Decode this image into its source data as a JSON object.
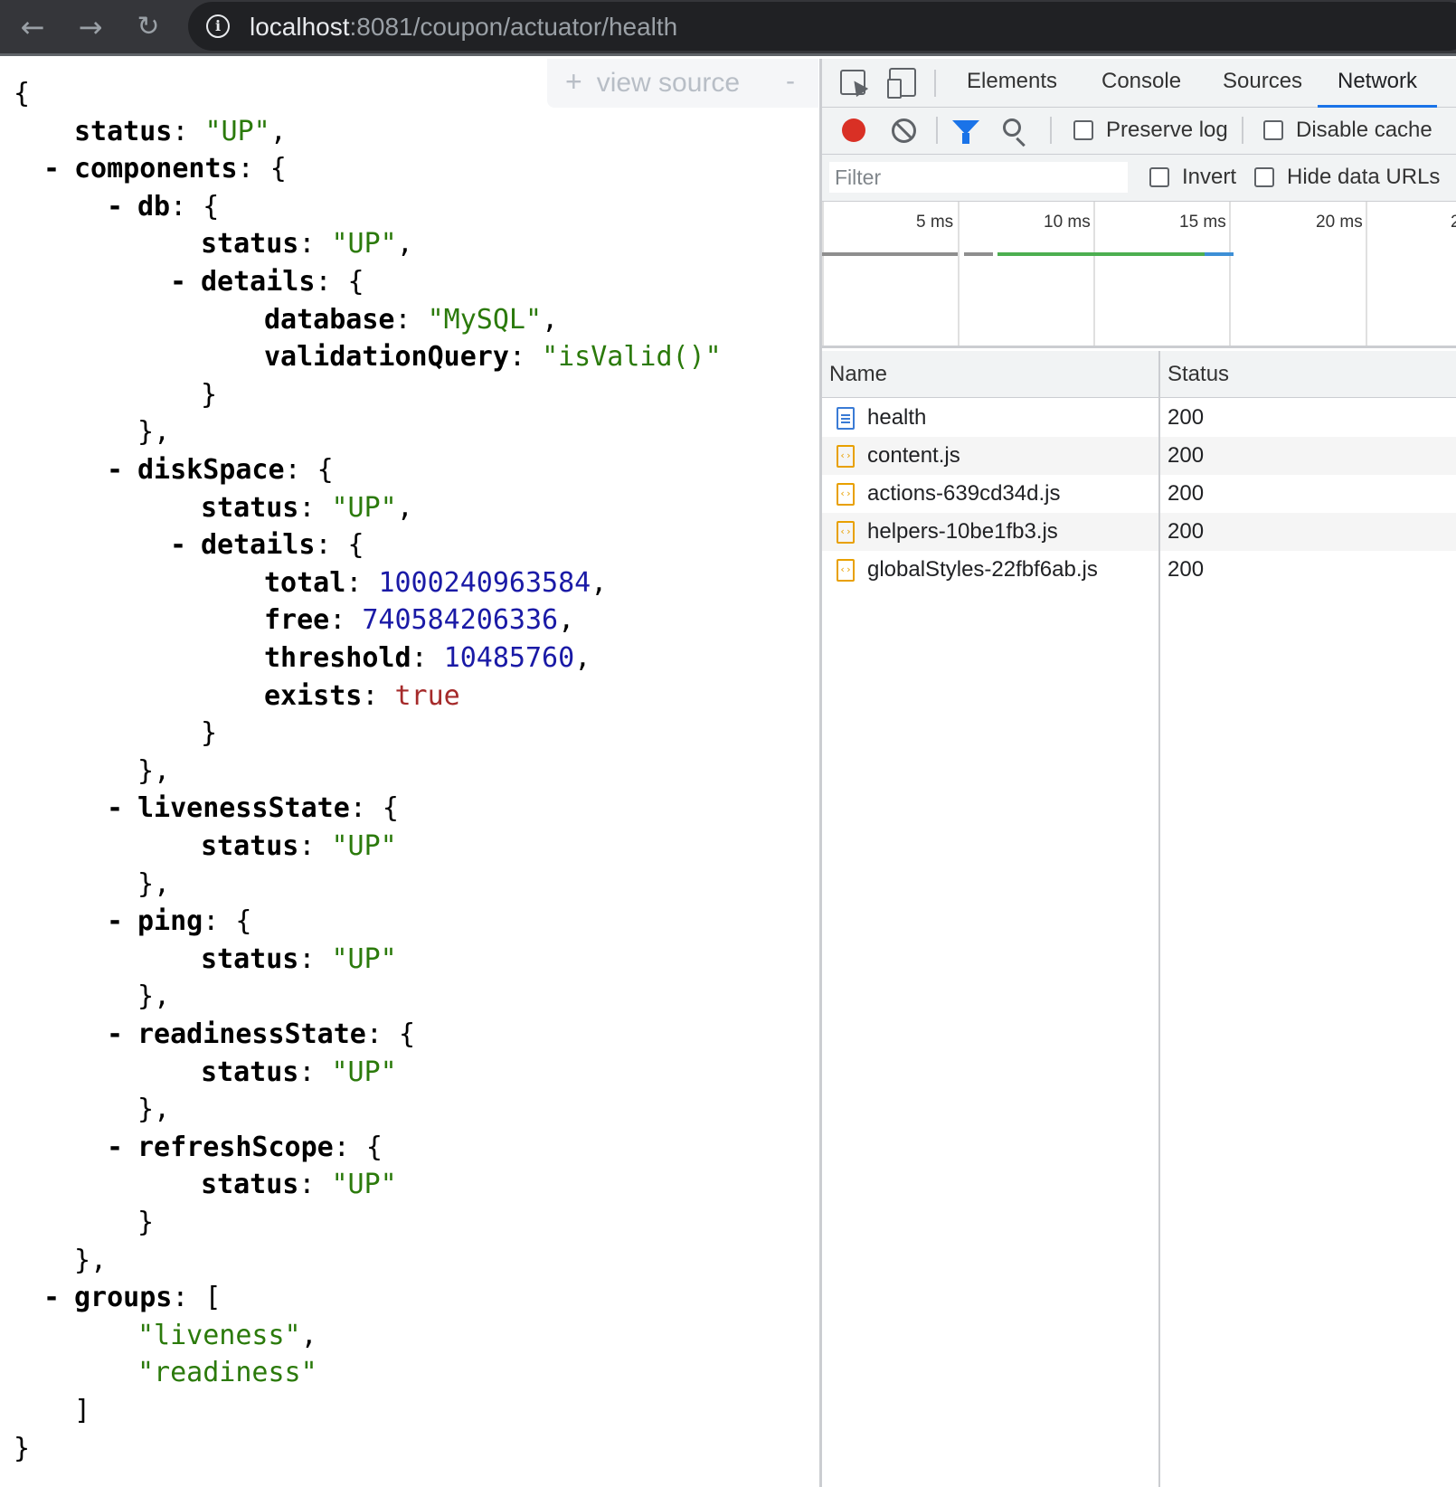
{
  "browser": {
    "nav": {
      "back_icon": "←",
      "forward_icon": "→",
      "reload_icon": "↻"
    },
    "omnibox": {
      "info_icon": "i",
      "url_host": "localhost",
      "url_rest": ":8081/coupon/actuator/health"
    }
  },
  "json_viewer": {
    "view_source": {
      "plus": "+",
      "label": "view source",
      "minus": "-"
    },
    "lines": [
      {
        "indent": 0,
        "collapse": false,
        "parts": [
          {
            "t": "p",
            "v": "{"
          }
        ]
      },
      {
        "indent": 1,
        "collapse": false,
        "parts": [
          {
            "t": "k",
            "v": "status"
          },
          {
            "t": "p",
            "v": ": "
          },
          {
            "t": "s",
            "v": "\"UP\""
          },
          {
            "t": "p",
            "v": ","
          }
        ]
      },
      {
        "indent": 1,
        "collapse": true,
        "parts": [
          {
            "t": "k",
            "v": "components"
          },
          {
            "t": "p",
            "v": ": {"
          }
        ]
      },
      {
        "indent": 2,
        "collapse": true,
        "parts": [
          {
            "t": "k",
            "v": "db"
          },
          {
            "t": "p",
            "v": ": {"
          }
        ]
      },
      {
        "indent": 3,
        "collapse": false,
        "parts": [
          {
            "t": "k",
            "v": "status"
          },
          {
            "t": "p",
            "v": ": "
          },
          {
            "t": "s",
            "v": "\"UP\""
          },
          {
            "t": "p",
            "v": ","
          }
        ]
      },
      {
        "indent": 3,
        "collapse": true,
        "parts": [
          {
            "t": "k",
            "v": "details"
          },
          {
            "t": "p",
            "v": ": {"
          }
        ]
      },
      {
        "indent": 4,
        "collapse": false,
        "parts": [
          {
            "t": "k",
            "v": "database"
          },
          {
            "t": "p",
            "v": ": "
          },
          {
            "t": "s",
            "v": "\"MySQL\""
          },
          {
            "t": "p",
            "v": ","
          }
        ]
      },
      {
        "indent": 4,
        "collapse": false,
        "parts": [
          {
            "t": "k",
            "v": "validationQuery"
          },
          {
            "t": "p",
            "v": ": "
          },
          {
            "t": "s",
            "v": "\"isValid()\""
          }
        ]
      },
      {
        "indent": 3,
        "collapse": false,
        "parts": [
          {
            "t": "p",
            "v": "}"
          }
        ]
      },
      {
        "indent": 2,
        "collapse": false,
        "parts": [
          {
            "t": "p",
            "v": "},"
          }
        ]
      },
      {
        "indent": 2,
        "collapse": true,
        "parts": [
          {
            "t": "k",
            "v": "diskSpace"
          },
          {
            "t": "p",
            "v": ": {"
          }
        ]
      },
      {
        "indent": 3,
        "collapse": false,
        "parts": [
          {
            "t": "k",
            "v": "status"
          },
          {
            "t": "p",
            "v": ": "
          },
          {
            "t": "s",
            "v": "\"UP\""
          },
          {
            "t": "p",
            "v": ","
          }
        ]
      },
      {
        "indent": 3,
        "collapse": true,
        "parts": [
          {
            "t": "k",
            "v": "details"
          },
          {
            "t": "p",
            "v": ": {"
          }
        ]
      },
      {
        "indent": 4,
        "collapse": false,
        "parts": [
          {
            "t": "k",
            "v": "total"
          },
          {
            "t": "p",
            "v": ": "
          },
          {
            "t": "n",
            "v": "1000240963584"
          },
          {
            "t": "p",
            "v": ","
          }
        ]
      },
      {
        "indent": 4,
        "collapse": false,
        "parts": [
          {
            "t": "k",
            "v": "free"
          },
          {
            "t": "p",
            "v": ": "
          },
          {
            "t": "n",
            "v": "740584206336"
          },
          {
            "t": "p",
            "v": ","
          }
        ]
      },
      {
        "indent": 4,
        "collapse": false,
        "parts": [
          {
            "t": "k",
            "v": "threshold"
          },
          {
            "t": "p",
            "v": ": "
          },
          {
            "t": "n",
            "v": "10485760"
          },
          {
            "t": "p",
            "v": ","
          }
        ]
      },
      {
        "indent": 4,
        "collapse": false,
        "parts": [
          {
            "t": "k",
            "v": "exists"
          },
          {
            "t": "p",
            "v": ": "
          },
          {
            "t": "b",
            "v": "true"
          }
        ]
      },
      {
        "indent": 3,
        "collapse": false,
        "parts": [
          {
            "t": "p",
            "v": "}"
          }
        ]
      },
      {
        "indent": 2,
        "collapse": false,
        "parts": [
          {
            "t": "p",
            "v": "},"
          }
        ]
      },
      {
        "indent": 2,
        "collapse": true,
        "parts": [
          {
            "t": "k",
            "v": "livenessState"
          },
          {
            "t": "p",
            "v": ": {"
          }
        ]
      },
      {
        "indent": 3,
        "collapse": false,
        "parts": [
          {
            "t": "k",
            "v": "status"
          },
          {
            "t": "p",
            "v": ": "
          },
          {
            "t": "s",
            "v": "\"UP\""
          }
        ]
      },
      {
        "indent": 2,
        "collapse": false,
        "parts": [
          {
            "t": "p",
            "v": "},"
          }
        ]
      },
      {
        "indent": 2,
        "collapse": true,
        "parts": [
          {
            "t": "k",
            "v": "ping"
          },
          {
            "t": "p",
            "v": ": {"
          }
        ]
      },
      {
        "indent": 3,
        "collapse": false,
        "parts": [
          {
            "t": "k",
            "v": "status"
          },
          {
            "t": "p",
            "v": ": "
          },
          {
            "t": "s",
            "v": "\"UP\""
          }
        ]
      },
      {
        "indent": 2,
        "collapse": false,
        "parts": [
          {
            "t": "p",
            "v": "},"
          }
        ]
      },
      {
        "indent": 2,
        "collapse": true,
        "parts": [
          {
            "t": "k",
            "v": "readinessState"
          },
          {
            "t": "p",
            "v": ": {"
          }
        ]
      },
      {
        "indent": 3,
        "collapse": false,
        "parts": [
          {
            "t": "k",
            "v": "status"
          },
          {
            "t": "p",
            "v": ": "
          },
          {
            "t": "s",
            "v": "\"UP\""
          }
        ]
      },
      {
        "indent": 2,
        "collapse": false,
        "parts": [
          {
            "t": "p",
            "v": "},"
          }
        ]
      },
      {
        "indent": 2,
        "collapse": true,
        "parts": [
          {
            "t": "k",
            "v": "refreshScope"
          },
          {
            "t": "p",
            "v": ": {"
          }
        ]
      },
      {
        "indent": 3,
        "collapse": false,
        "parts": [
          {
            "t": "k",
            "v": "status"
          },
          {
            "t": "p",
            "v": ": "
          },
          {
            "t": "s",
            "v": "\"UP\""
          }
        ]
      },
      {
        "indent": 2,
        "collapse": false,
        "parts": [
          {
            "t": "p",
            "v": "}"
          }
        ]
      },
      {
        "indent": 1,
        "collapse": false,
        "parts": [
          {
            "t": "p",
            "v": "},"
          }
        ]
      },
      {
        "indent": 1,
        "collapse": true,
        "parts": [
          {
            "t": "k",
            "v": "groups"
          },
          {
            "t": "p",
            "v": ": ["
          }
        ]
      },
      {
        "indent": 2,
        "collapse": false,
        "parts": [
          {
            "t": "s",
            "v": "\"liveness\""
          },
          {
            "t": "p",
            "v": ","
          }
        ]
      },
      {
        "indent": 2,
        "collapse": false,
        "parts": [
          {
            "t": "s",
            "v": "\"readiness\""
          }
        ]
      },
      {
        "indent": 1,
        "collapse": false,
        "parts": [
          {
            "t": "p",
            "v": "]"
          }
        ]
      },
      {
        "indent": 0,
        "collapse": false,
        "parts": [
          {
            "t": "p",
            "v": "}"
          }
        ]
      }
    ],
    "collapse_glyph": "-"
  },
  "devtools": {
    "tabs": {
      "elements": "Elements",
      "console": "Console",
      "sources": "Sources",
      "network": "Network"
    },
    "toolbar": {
      "preserve_log": "Preserve log",
      "disable_cache": "Disable cache"
    },
    "filterbar": {
      "filter_placeholder": "Filter",
      "invert": "Invert",
      "hide_data_urls": "Hide data URLs"
    },
    "timeline": {
      "ticks": [
        "5 ms",
        "10 ms",
        "15 ms",
        "20 ms",
        "2"
      ]
    },
    "table": {
      "headers": {
        "name": "Name",
        "status": "Status"
      },
      "rows": [
        {
          "name": "health",
          "status": "200",
          "type": "document"
        },
        {
          "name": "content.js",
          "status": "200",
          "type": "script"
        },
        {
          "name": "actions-639cd34d.js",
          "status": "200",
          "type": "script"
        },
        {
          "name": "helpers-10be1fb3.js",
          "status": "200",
          "type": "script"
        },
        {
          "name": "globalStyles-22fbf6ab.js",
          "status": "200",
          "type": "script"
        }
      ]
    }
  },
  "colors": {
    "json_string": "#2b7a0b",
    "json_number": "#1a1aa6",
    "json_boolean": "#a52a2a",
    "devtools_accent": "#1a73e8",
    "record_red": "#d93025"
  }
}
